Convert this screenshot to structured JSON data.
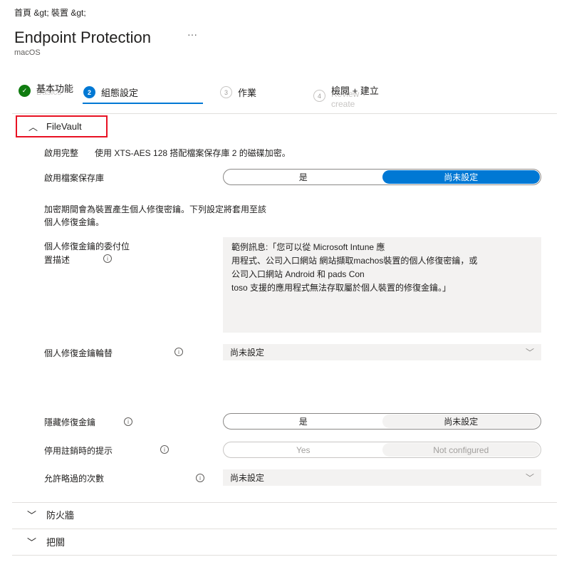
{
  "breadcrumb": "首頁 &gt;  裝置 &gt;",
  "header": {
    "title": "Endpoint Protection",
    "more": "···",
    "subtitle": "macOS"
  },
  "steps": [
    {
      "num": "✓",
      "label": "基本功能",
      "ghost": "Basics",
      "state": "done"
    },
    {
      "num": "2",
      "label": "組態設定",
      "state": "current"
    },
    {
      "num": "3",
      "label": "作業",
      "state": "todo"
    },
    {
      "num": "4",
      "label": "檢閱 + 建立",
      "ghost": "Review + create",
      "state": "todo"
    }
  ],
  "filevault": {
    "title": "FileVault",
    "enable_label": "啟用完整",
    "enable_value": "使用 XTS-AES 128 搭配檔案保存庫 2 的磁碟加密。",
    "vault_label": "啟用檔案保存庫",
    "vault_options": [
      "是",
      "尚未設定"
    ],
    "note": "加密期間會為裝置產生個人修復密鑰。下列設定將套用至該\n個人修復金鑰。",
    "escrow_label": "個人修復金鑰的委付位\n置描述",
    "escrow_lines": [
      "範例訊息:「您可以從 Microsoft Intune 應",
      "用程式、公司入口網站 網站擷取machos裝置的個人修復密鑰，或",
      "公司入口網站 Android 和 pads Con",
      "toso 支援的應用程式無法存取屬於個人裝置的修復金鑰。」"
    ],
    "rotation_label": "個人修復金鑰輪替",
    "rotation_value": "尚未設定",
    "hide_label": "隱藏修復金鑰",
    "hide_options": [
      "是",
      "尚未設定"
    ],
    "disable_prompt_label": "停用註銷時的提示",
    "disable_prompt_options": [
      "Yes",
      "Not configured"
    ],
    "bypass_label": "允許略過的次數",
    "bypass_value": "尚未設定"
  },
  "sections": [
    "防火牆",
    "把關"
  ],
  "colors": {
    "accent": "#0078d4",
    "success": "#107c10",
    "highlight": "#e81123"
  }
}
